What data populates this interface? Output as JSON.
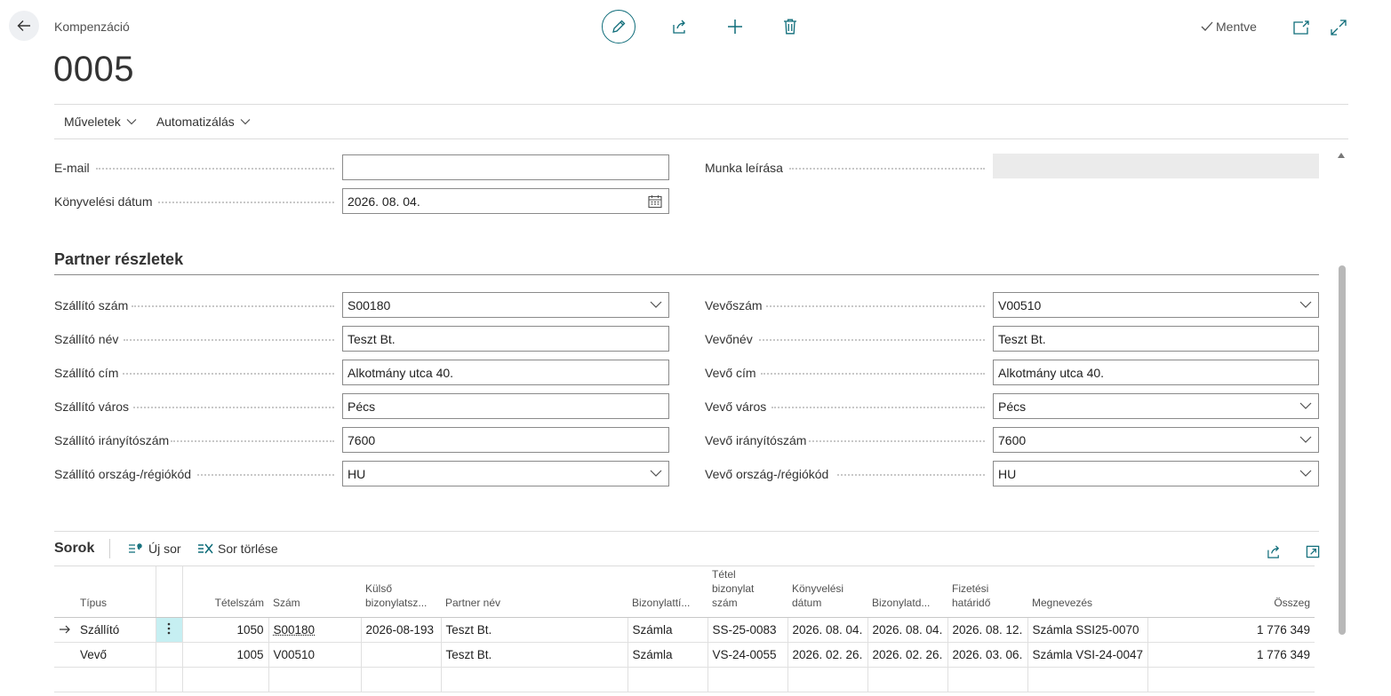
{
  "header": {
    "breadcrumb": "Kompenzáció",
    "title": "0005",
    "saved_status": "Mentve"
  },
  "action_bar": {
    "menus": [
      "Műveletek",
      "Automatizálás"
    ]
  },
  "general": {
    "email_label": "E-mail",
    "email_value": "",
    "posting_date_label": "Könyvelési dátum",
    "posting_date_value": "2026. 08. 04.",
    "work_description_label": "Munka leírása",
    "work_description_value": ""
  },
  "partner": {
    "section_title": "Partner részletek",
    "vendor": {
      "no_label": "Szállító szám",
      "no_value": "S00180",
      "name_label": "Szállító név",
      "name_value": "Teszt Bt.",
      "address_label": "Szállító cím",
      "address_value": "Alkotmány utca 40.",
      "city_label": "Szállító város",
      "city_value": "Pécs",
      "postcode_label": "Szállító irányítószám",
      "postcode_value": "7600",
      "country_label": "Szállító ország-/régiókód",
      "country_value": "HU"
    },
    "customer": {
      "no_label": "Vevőszám",
      "no_value": "V00510",
      "name_label": "Vevőnév",
      "name_value": "Teszt Bt.",
      "address_label": "Vevő cím",
      "address_value": "Alkotmány utca 40.",
      "city_label": "Vevő város",
      "city_value": "Pécs",
      "postcode_label": "Vevő irányítószám",
      "postcode_value": "7600",
      "country_label": "Vevő ország-/régiókód",
      "country_value": "HU"
    }
  },
  "lines": {
    "title": "Sorok",
    "new_line": "Új sor",
    "delete_line": "Sor törlése",
    "columns": {
      "type": "Típus",
      "entry_no": "Tételszám",
      "no": "Szám",
      "ext_doc_1": "Külső",
      "ext_doc_2": "bizonylatsz...",
      "partner_name": "Partner név",
      "doc_type": "Bizonylattí...",
      "entry_doc_1": "Tétel",
      "entry_doc_2": "bizonylat",
      "entry_doc_3": "szám",
      "posting_date_1": "Könyvelési",
      "posting_date_2": "dátum",
      "doc_date": "Bizonylatd...",
      "due_date_1": "Fizetési",
      "due_date_2": "határidő",
      "description": "Megnevezés",
      "amount": "Összeg"
    },
    "rows": [
      {
        "type": "Szállító",
        "entry_no": "1050",
        "no": "S00180",
        "ext_doc": "2026-08-193",
        "partner_name": "Teszt Bt.",
        "doc_type": "Számla",
        "entry_doc": "SS-25-0083",
        "posting_date": "2026. 08. 04.",
        "doc_date": "2026. 08. 04.",
        "due_date": "2026. 08. 12.",
        "description": "Számla SSI25-0070",
        "amount": "1 776 349"
      },
      {
        "type": "Vevő",
        "entry_no": "1005",
        "no": "V00510",
        "ext_doc": "",
        "partner_name": "Teszt Bt.",
        "doc_type": "Számla",
        "entry_doc": "VS-24-0055",
        "posting_date": "2026. 02. 26.",
        "doc_date": "2026. 02. 26.",
        "due_date": "2026. 03. 06.",
        "description": "Számla VSI-24-0047",
        "amount": "1 776 349"
      }
    ]
  },
  "colors": {
    "accent": "#0f6d7a",
    "selected_cell": "#c6eff2"
  }
}
